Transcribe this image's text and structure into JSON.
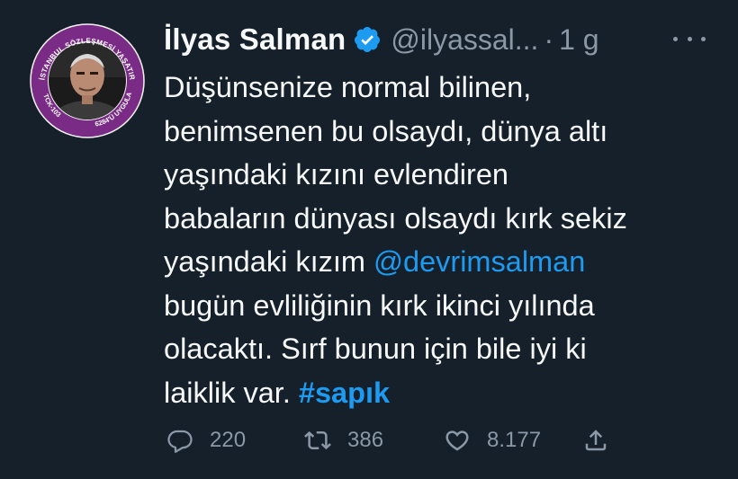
{
  "author": {
    "name": "İlyas Salman",
    "handle": "@ilyassal...",
    "separator": "·",
    "time": "1 g",
    "verified": true,
    "avatar": {
      "ring_color": "#7a2b86",
      "ring_text_top": "İSTANBUL SÖZLEŞMESİ YAŞATIR",
      "ring_text_left": "TCK-103",
      "ring_text_right": "6284'Ü UYGULA"
    }
  },
  "tweet": {
    "lines": [
      "Düşünsenize normal bilinen,",
      "benimsenen bu olsaydı, dünya altı",
      "yaşındaki kızını evlendiren",
      "babaların dünyası olsaydı kırk sekiz"
    ],
    "line5_prefix": "yaşındaki kızım ",
    "mention": "@devrimsalman",
    "lines_after": [
      "bugün evliliğinin kırk ikinci yılında",
      "olacaktı. Sırf bunun için bile iyi ki"
    ],
    "line8_prefix": "laiklik var. ",
    "hashtag": "#sapık"
  },
  "actions": {
    "reply_count": "220",
    "retweet_count": "386",
    "like_count": "8.177"
  },
  "colors": {
    "background": "#15202b",
    "text": "#f7f9f9",
    "secondary": "#8b98a5",
    "accent": "#1d9bf0"
  },
  "icons": [
    "verified-badge-icon",
    "more-icon",
    "reply-icon",
    "retweet-icon",
    "like-icon",
    "share-icon"
  ]
}
